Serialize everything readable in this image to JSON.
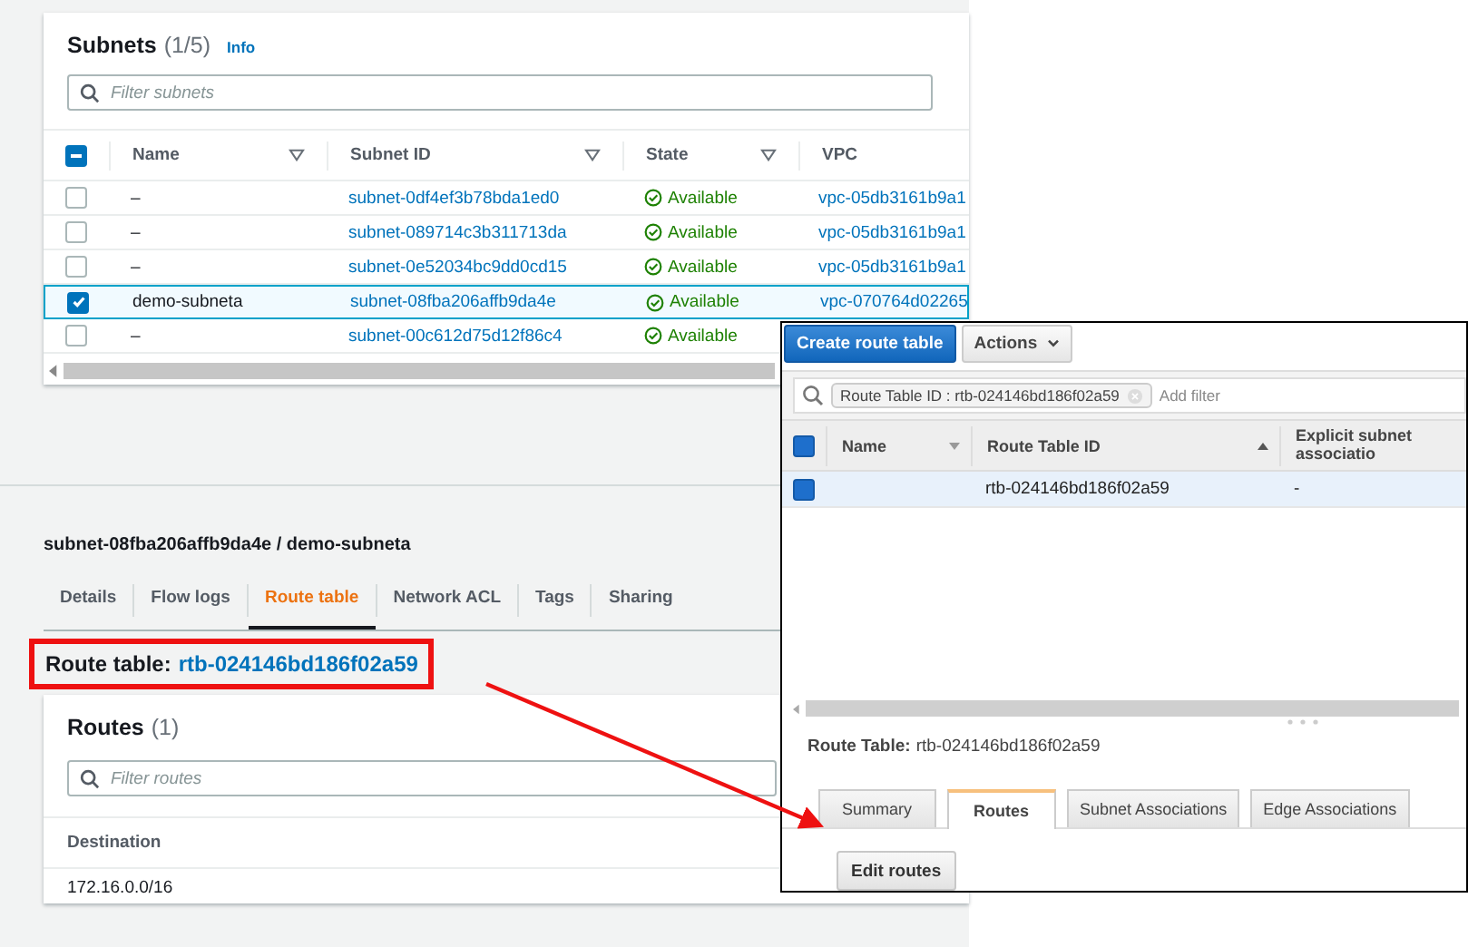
{
  "subnets_panel": {
    "title": "Subnets",
    "count": "(1/5)",
    "info": "Info",
    "filter_placeholder": "Filter subnets",
    "select_all_indeterminate": true,
    "columns": [
      "Name",
      "Subnet ID",
      "State",
      "VPC"
    ],
    "rows": [
      {
        "name": "–",
        "subnet_id": "subnet-0df4ef3b78bda1ed0",
        "state": "Available",
        "vpc": "vpc-05db3161b9a1",
        "selected": false
      },
      {
        "name": "–",
        "subnet_id": "subnet-089714c3b311713da",
        "state": "Available",
        "vpc": "vpc-05db3161b9a1",
        "selected": false
      },
      {
        "name": "–",
        "subnet_id": "subnet-0e52034bc9dd0cd15",
        "state": "Available",
        "vpc": "vpc-05db3161b9a1",
        "selected": false
      },
      {
        "name": "demo-subneta",
        "subnet_id": "subnet-08fba206affb9da4e",
        "state": "Available",
        "vpc": "vpc-070764d02265",
        "selected": true
      },
      {
        "name": "–",
        "subnet_id": "subnet-00c612d75d12f86c4",
        "state": "Available",
        "selected": false
      }
    ]
  },
  "subnet_detail": {
    "breadcrumb": "subnet-08fba206affb9da4e / demo-subneta",
    "tabs": [
      {
        "label": "Details",
        "selected": false
      },
      {
        "label": "Flow logs",
        "selected": false
      },
      {
        "label": "Route table",
        "selected": true
      },
      {
        "label": "Network ACL",
        "selected": false
      },
      {
        "label": "Tags",
        "selected": false
      },
      {
        "label": "Sharing",
        "selected": false
      }
    ],
    "route_table_label": "Route table:",
    "route_table_id": "rtb-024146bd186f02a59",
    "routes": {
      "title": "Routes",
      "count": "(1)",
      "filter_placeholder": "Filter routes",
      "columns": [
        "Destination"
      ],
      "rows": [
        {
          "destination": "172.16.0.0/16"
        }
      ]
    }
  },
  "route_tables_window": {
    "buttons": [
      {
        "label": "Create route table",
        "kind": "primary"
      },
      {
        "label": "Actions",
        "kind": "dropdown"
      }
    ],
    "filter_tag": "Route Table ID : rtb-024146bd186f02a59",
    "filter_placeholder": "Add filter",
    "select_all_checked": true,
    "columns": [
      "Name",
      "Route Table ID",
      "Explicit subnet associatio"
    ],
    "rows": [
      {
        "route_table_id": "rtb-024146bd186f02a59",
        "explicit_association": "-",
        "selected": true
      }
    ],
    "route_table_label": "Route Table:",
    "route_table_id": "rtb-024146bd186f02a59",
    "tabs": [
      {
        "label": "Summary",
        "selected": false
      },
      {
        "label": "Routes",
        "selected": true
      },
      {
        "label": "Subnet Associations",
        "selected": false
      },
      {
        "label": "Edge Associations",
        "selected": false
      }
    ],
    "edit_button": "Edit routes"
  }
}
